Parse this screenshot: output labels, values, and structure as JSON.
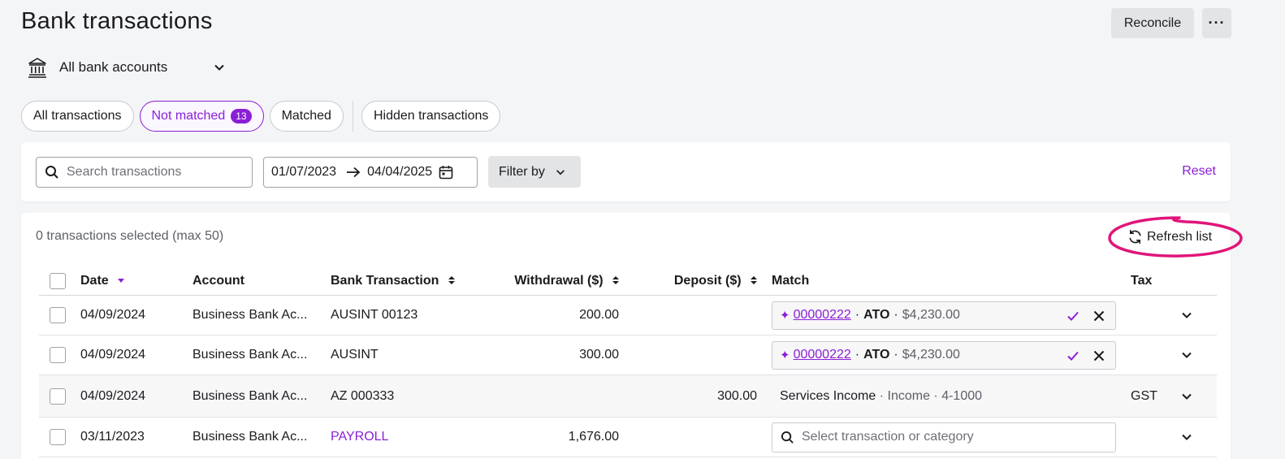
{
  "header": {
    "title": "Bank transactions",
    "reconcile_label": "Reconcile",
    "more_label": "···"
  },
  "account_selector": {
    "label": "All bank accounts"
  },
  "tabs": [
    {
      "label": "All transactions"
    },
    {
      "label": "Not matched",
      "count": "13",
      "active": true
    },
    {
      "label": "Matched"
    },
    {
      "label": "Hidden transactions"
    }
  ],
  "filters": {
    "search_placeholder": "Search transactions",
    "date_from": "01/07/2023",
    "date_to": "04/04/2025",
    "filter_by_label": "Filter by",
    "reset_label": "Reset"
  },
  "table": {
    "selected_info": "0 transactions selected (max 50)",
    "refresh_label": "Refresh list",
    "columns": {
      "date": "Date",
      "account": "Account",
      "bank_transaction": "Bank Transaction",
      "withdrawal": "Withdrawal ($)",
      "deposit": "Deposit ($)",
      "match": "Match",
      "tax": "Tax"
    },
    "rows": [
      {
        "date": "04/09/2024",
        "account": "Business Bank Ac...",
        "bank_transaction": "AUSINT 00123",
        "withdrawal": "200.00",
        "deposit": "",
        "match": {
          "ref": "00000222",
          "contact": "ATO",
          "amount": "$4,230.00"
        },
        "tax": ""
      },
      {
        "date": "04/09/2024",
        "account": "Business Bank Ac...",
        "bank_transaction": "AUSINT",
        "withdrawal": "300.00",
        "deposit": "",
        "match": {
          "ref": "00000222",
          "contact": "ATO",
          "amount": "$4,230.00"
        },
        "tax": ""
      },
      {
        "date": "04/09/2024",
        "account": "Business Bank Ac...",
        "bank_transaction": "AZ 000333",
        "withdrawal": "",
        "deposit": "300.00",
        "category": {
          "name": "Services Income",
          "type": "Income",
          "code": "4-1000"
        },
        "tax": "GST"
      },
      {
        "date": "03/11/2023",
        "account": "Business Bank Ac...",
        "bank_transaction": "PAYROLL",
        "withdrawal": "1,676.00",
        "deposit": "",
        "select_placeholder": "Select transaction or category",
        "tax": ""
      }
    ]
  },
  "colors": {
    "accent": "#8b1fd6",
    "annotation": "#e0157a"
  },
  "separator": "·"
}
